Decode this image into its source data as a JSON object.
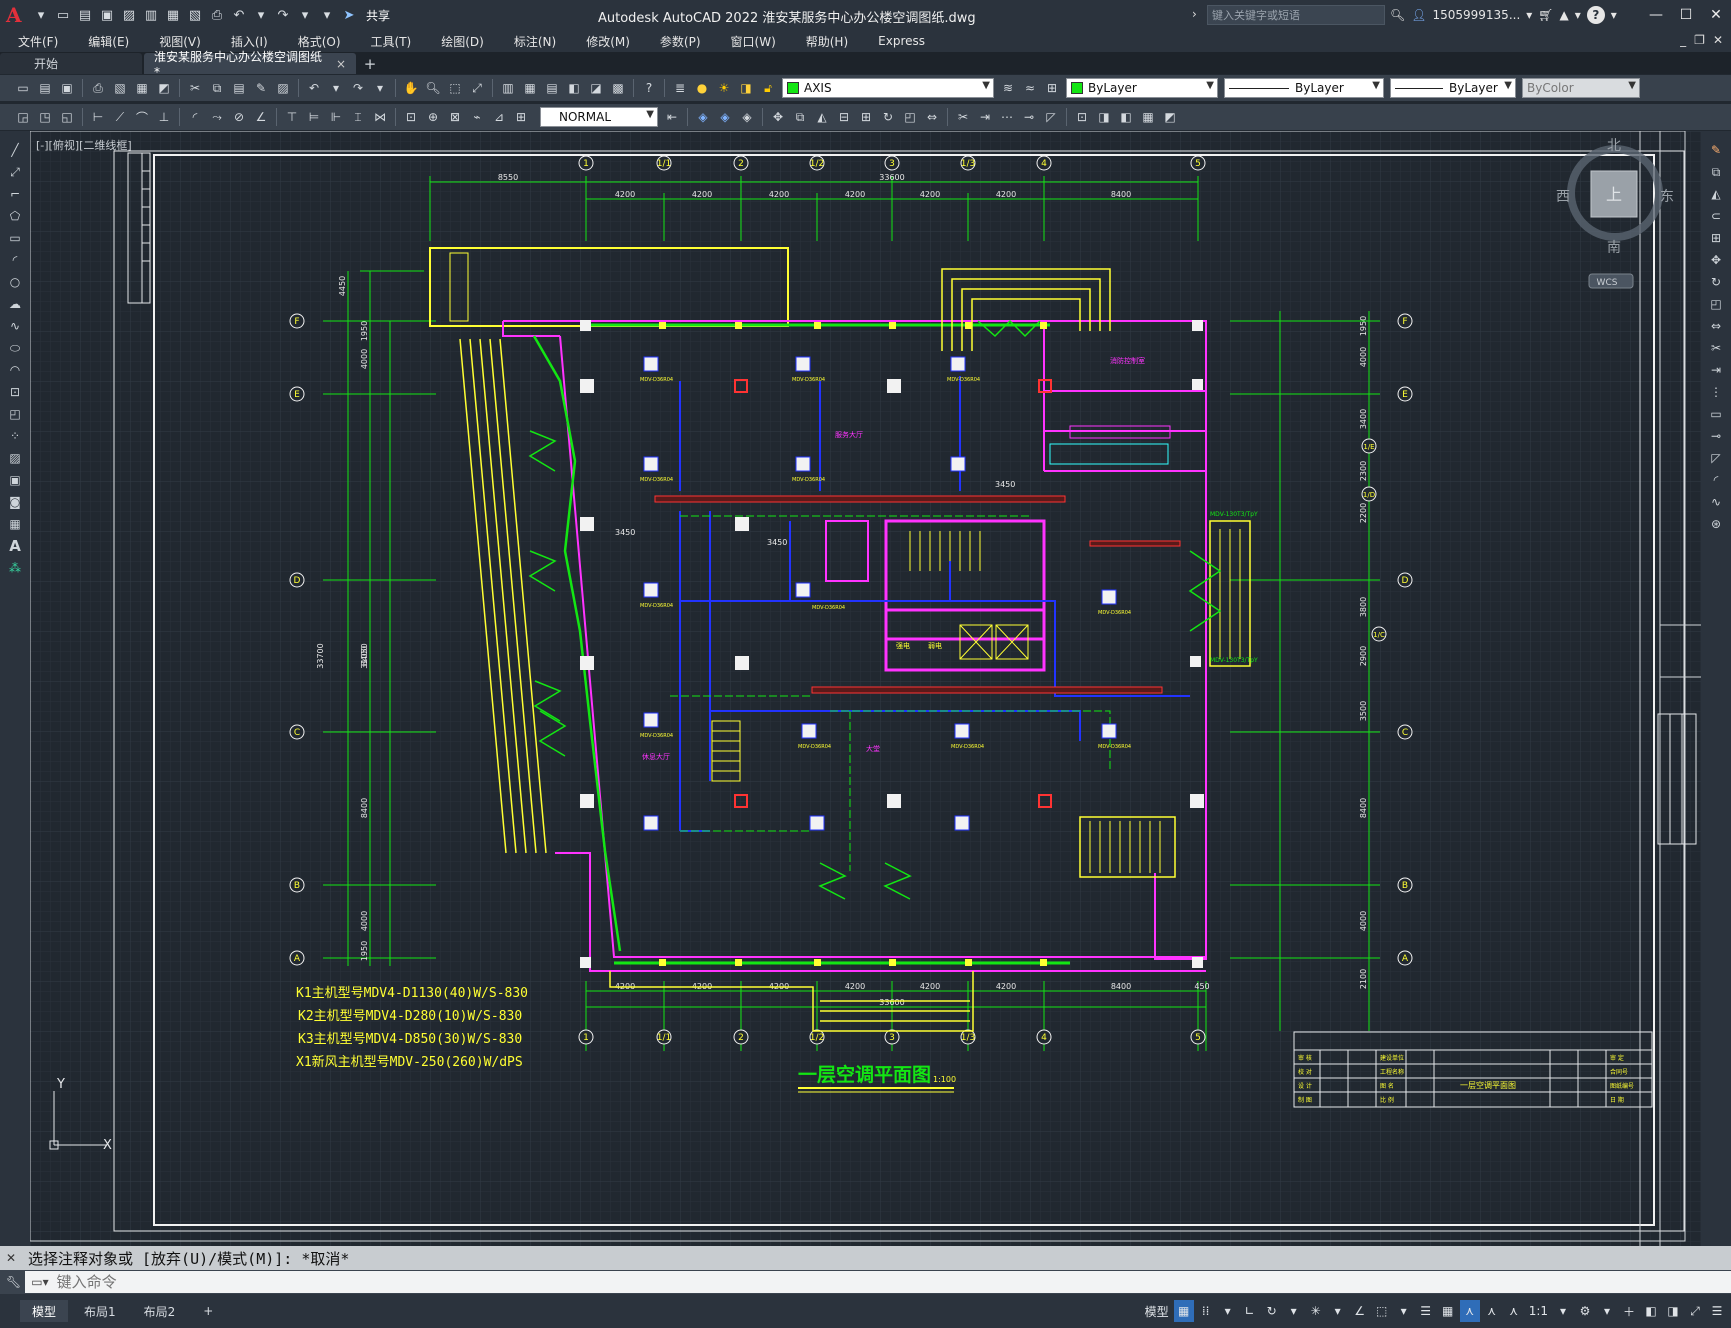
{
  "titlebar": {
    "share": "共享",
    "title": "Autodesk AutoCAD 2022    淮安某服务中心办公楼空调图纸.dwg",
    "search_placeholder": "键入关键字或短语",
    "user": "1505999135...",
    "help": "?"
  },
  "menus": [
    "文件(F)",
    "编辑(E)",
    "视图(V)",
    "插入(I)",
    "格式(O)",
    "工具(T)",
    "绘图(D)",
    "标注(N)",
    "修改(M)",
    "参数(P)",
    "窗口(W)",
    "帮助(H)",
    "Express"
  ],
  "tabs": {
    "start": "开始",
    "active": "淮安某服务中心办公楼空调图纸*",
    "close": "×",
    "new": "+"
  },
  "layer": {
    "name": "AXIS",
    "color": "ByLayer",
    "linetype": "ByLayer",
    "lineweight": "ByLayer",
    "plotstyle": "ByColor"
  },
  "dimstyle": "NORMAL",
  "viewport_label": "[-][俯视][二维线框]",
  "viewcube": {
    "north": "北",
    "south": "南",
    "east": "东",
    "west": "西",
    "top": "上",
    "wcs": "WCS"
  },
  "ucs": {
    "x": "X",
    "y": "Y"
  },
  "drawing": {
    "col_bubbles": [
      "1",
      "1/1",
      "2",
      "1/2",
      "3",
      "1/3",
      "4",
      "5"
    ],
    "row_bubbles": [
      "F",
      "E",
      "D",
      "C",
      "B",
      "A"
    ],
    "right_bubbles": [
      "F",
      "E",
      "1/E",
      "1/D",
      "D",
      "1/C",
      "C",
      "B",
      "A"
    ],
    "top_dims": [
      "4200",
      "4200",
      "4200",
      "4200",
      "4200",
      "4200",
      "8400"
    ],
    "top_overall": "33600",
    "top_left_dim": "8550",
    "bottom_dims": [
      "4200",
      "4200",
      "4200",
      "4200",
      "4200",
      "4200",
      "8400",
      "450"
    ],
    "bottom_overall": "33600",
    "left_dims": [
      "4450",
      "1950",
      "4000",
      "8400",
      "8400",
      "4000",
      "1950"
    ],
    "left_overall": [
      "33700",
      "31050"
    ],
    "right_dims": [
      "1950",
      "4000",
      "3400",
      "2300",
      "2200",
      "3800",
      "2900",
      "3500",
      "8400",
      "4000",
      "2100"
    ],
    "notes": [
      "K1主机型号MDV4-D1130(40)W/S-830",
      "K2主机型号MDV4-D280(10)W/S-830",
      "K3主机型号MDV4-D850(30)W/S-830",
      "X1新风主机型号MDV-250(260)W/dPS"
    ],
    "plan_title": "一层空调平面图",
    "plan_scale": "1:100",
    "unit_labels": [
      "MDV-D36R04",
      "MDV-D36R04",
      "MDV-D36R04",
      "MDV-D36R04",
      "MDV-D36R04",
      "MDV-D36R04",
      "MDV-D36R04",
      "MDV-D36R04",
      "MDV-D36R04",
      "MDV-D36R04",
      "MDV-D36R04",
      "MDV-D36R04"
    ],
    "dim_3450": "3450",
    "mdv_label": "MDV-130T3/TpY",
    "room_labels": [
      "服务大厅",
      "大堂",
      "休息大厅",
      "强电",
      "弱电",
      "消防控制室"
    ],
    "tb_rows": [
      [
        "审 核",
        "",
        "",
        "建设单位",
        "",
        "",
        "",
        "审 定"
      ],
      [
        "校 对",
        "",
        "",
        "工程名称",
        "",
        "",
        "",
        "合同号"
      ],
      [
        "设 计",
        "",
        "",
        "图 名",
        "",
        "一层空调平面图",
        "",
        "图纸编号"
      ],
      [
        "制 图",
        "",
        "",
        "比 例",
        "",
        "",
        "",
        "日 期"
      ]
    ],
    "tb_title": "一层空调平面图"
  },
  "command": {
    "history": "选择注释对象或 [放弃(U)/模式(M)]: *取消*",
    "placeholder": "键入命令"
  },
  "status": {
    "layouts": [
      "模型",
      "布局1",
      "布局2"
    ],
    "plus": "+",
    "model": "模型",
    "scale": "1:1"
  }
}
